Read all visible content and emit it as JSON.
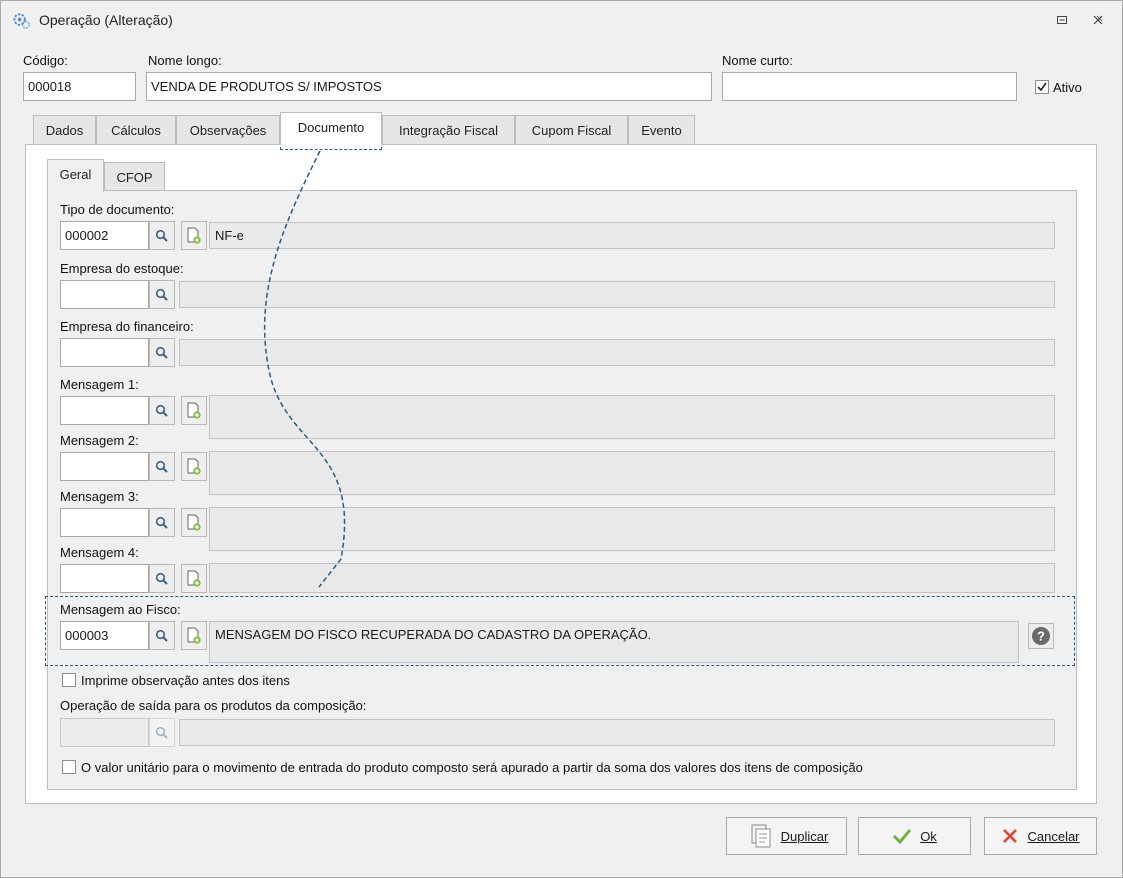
{
  "window": {
    "title": "Operação (Alteração)"
  },
  "header": {
    "codigo_label": "Código:",
    "codigo_value": "000018",
    "nome_longo_label": "Nome longo:",
    "nome_longo_value": "VENDA DE PRODUTOS S/ IMPOSTOS",
    "nome_curto_label": "Nome curto:",
    "nome_curto_value": "",
    "ativo_label": "Ativo",
    "ativo_checked": true
  },
  "tabs": [
    {
      "label": "Dados"
    },
    {
      "label": "Cálculos"
    },
    {
      "label": "Observações"
    },
    {
      "label": "Documento",
      "active": true
    },
    {
      "label": "Integração Fiscal"
    },
    {
      "label": "Cupom Fiscal"
    },
    {
      "label": "Evento"
    }
  ],
  "subtabs": [
    {
      "label": "Geral",
      "active": true
    },
    {
      "label": "CFOP"
    }
  ],
  "form": {
    "tipo_documento": {
      "label": "Tipo de documento:",
      "code": "000002",
      "desc": "NF-e"
    },
    "empresa_estoque": {
      "label": "Empresa do estoque:",
      "code": "",
      "desc": ""
    },
    "empresa_financeiro": {
      "label": "Empresa do financeiro:",
      "code": "",
      "desc": ""
    },
    "mensagem1": {
      "label": "Mensagem 1:",
      "code": "",
      "desc": ""
    },
    "mensagem2": {
      "label": "Mensagem 2:",
      "code": "",
      "desc": ""
    },
    "mensagem3": {
      "label": "Mensagem 3:",
      "code": "",
      "desc": ""
    },
    "mensagem4": {
      "label": "Mensagem 4:",
      "code": "",
      "desc": ""
    },
    "mensagem_fisco": {
      "label": "Mensagem ao Fisco:",
      "code": "000003",
      "desc": "MENSAGEM DO FISCO RECUPERADA DO CADASTRO DA OPERAÇÃO."
    },
    "imprime_obs_label": "Imprime observação antes dos itens",
    "imprime_obs_checked": false,
    "operacao_saida": {
      "label": "Operação de saída para os produtos da composição:",
      "code": "",
      "desc": ""
    },
    "valor_unitario_label": "O valor unitário para o movimento de entrada do produto composto será apurado a partir da soma dos valores dos itens de composição",
    "valor_unitario_checked": false
  },
  "footer": {
    "duplicar_label": "Duplicar",
    "ok_label": "Ok",
    "cancelar_label": "Cancelar"
  },
  "colors": {
    "accent_dashed": "#2a5a8a",
    "ok_check": "#6cb33f",
    "cancel_x": "#e0442f"
  }
}
